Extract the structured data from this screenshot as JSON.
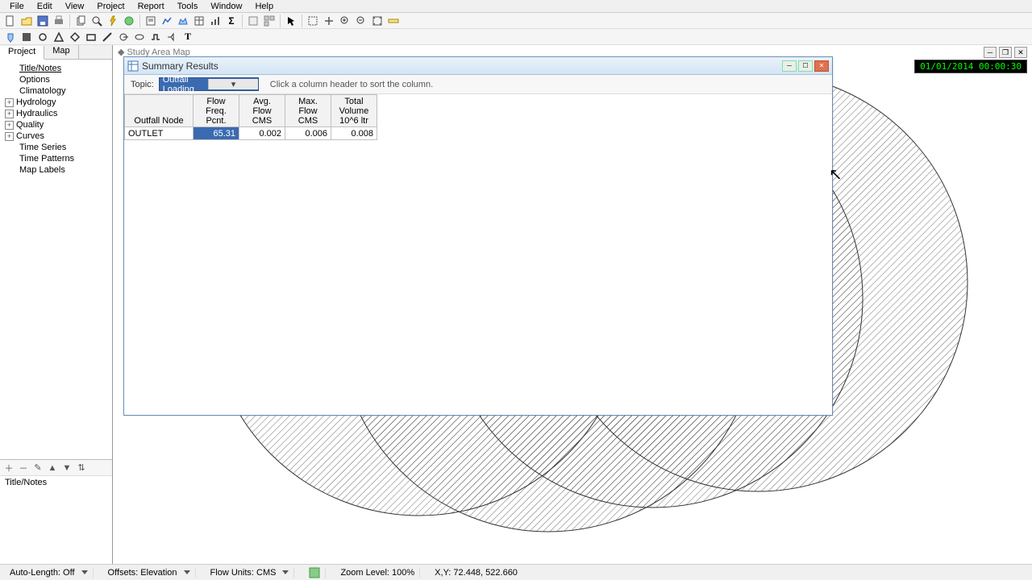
{
  "menu": {
    "items": [
      "File",
      "Edit",
      "View",
      "Project",
      "Report",
      "Tools",
      "Window",
      "Help"
    ]
  },
  "sidebar": {
    "tabs": [
      "Project",
      "Map"
    ],
    "active_tab": 0,
    "items": [
      {
        "label": "Title/Notes",
        "exp": null,
        "sel": true
      },
      {
        "label": "Options",
        "exp": null
      },
      {
        "label": "Climatology",
        "exp": null
      },
      {
        "label": "Hydrology",
        "exp": "+"
      },
      {
        "label": "Hydraulics",
        "exp": "+"
      },
      {
        "label": "Quality",
        "exp": "+"
      },
      {
        "label": "Curves",
        "exp": "+"
      },
      {
        "label": "Time Series",
        "exp": null
      },
      {
        "label": "Time Patterns",
        "exp": null
      },
      {
        "label": "Map Labels",
        "exp": null
      }
    ],
    "lower_label": "Title/Notes"
  },
  "map": {
    "inner_title": "Study Area Map",
    "datetime": "01/01/2014 00:00:30"
  },
  "results_window": {
    "title": "Summary Results",
    "topic_label": "Topic:",
    "topic_value": "Outfall Loading",
    "hint": "Click a column header to sort the column.",
    "columns": [
      "Outfall Node",
      "Flow\nFreq.\nPcnt.",
      "Avg.\nFlow\nCMS",
      "Max.\nFlow\nCMS",
      "Total\nVolume\n10^6 ltr"
    ],
    "rows": [
      {
        "name": "OUTLET",
        "flow_freq": "65.31",
        "avg_flow": "0.002",
        "max_flow": "0.006",
        "total_vol": "0.008",
        "sel_col": 1
      }
    ]
  },
  "status": {
    "auto_length": "Auto-Length: Off",
    "offsets": "Offsets: Elevation",
    "flow_units": "Flow Units: CMS",
    "zoom": "Zoom Level: 100%",
    "coords": "X,Y: 72.448, 522.660"
  }
}
